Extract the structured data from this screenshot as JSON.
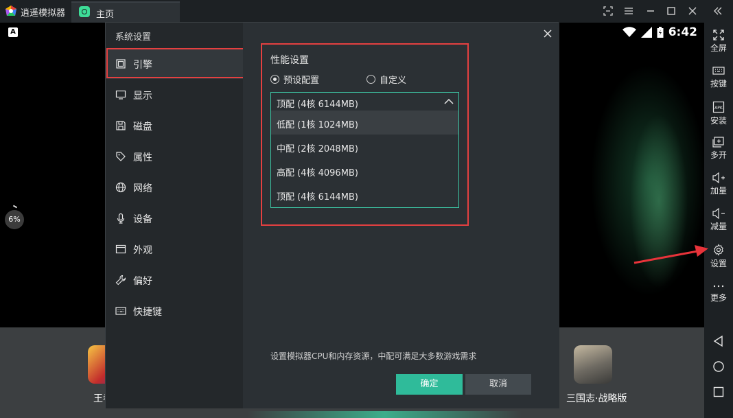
{
  "titlebar": {
    "app_title": "逍遥模拟器",
    "tab_label": "主页",
    "controls": [
      "screenshot-icon",
      "menu-icon",
      "minimize-icon",
      "maximize-icon",
      "close-icon",
      "collapse-icon"
    ]
  },
  "status_bar": {
    "time": "6:42",
    "icons": [
      "wifi-icon",
      "signal-icon",
      "battery-icon"
    ]
  },
  "screen": {
    "progress_percent": "6%",
    "dock_apps": [
      {
        "label": "王者"
      },
      {
        "label": "三国志·战略版"
      }
    ]
  },
  "toolbar": {
    "items": [
      {
        "label": "全屏",
        "icon": "fullscreen-icon"
      },
      {
        "label": "按键",
        "icon": "keyboard-icon"
      },
      {
        "label": "安装",
        "icon": "apk-icon"
      },
      {
        "label": "多开",
        "icon": "multi-instance-icon"
      },
      {
        "label": "加量",
        "icon": "volume-up-icon"
      },
      {
        "label": "减量",
        "icon": "volume-down-icon"
      },
      {
        "label": "设置",
        "icon": "gear-icon"
      },
      {
        "label": "更多",
        "icon": "more-icon"
      }
    ]
  },
  "dialog": {
    "title": "系统设置",
    "nav": [
      {
        "label": "引擎",
        "icon": "engine-icon",
        "active": true
      },
      {
        "label": "显示",
        "icon": "display-icon"
      },
      {
        "label": "磁盘",
        "icon": "disk-icon"
      },
      {
        "label": "属性",
        "icon": "tag-icon"
      },
      {
        "label": "网络",
        "icon": "globe-icon"
      },
      {
        "label": "设备",
        "icon": "microphone-icon"
      },
      {
        "label": "外观",
        "icon": "window-icon"
      },
      {
        "label": "偏好",
        "icon": "wrench-icon"
      },
      {
        "label": "快捷键",
        "icon": "keyboard-icon"
      }
    ],
    "performance": {
      "title": "性能设置",
      "radio_preset": "预设配置",
      "radio_custom": "自定义",
      "selected": "顶配 (4核 6144MB)",
      "options": [
        "低配 (1核 1024MB)",
        "中配 (2核 2048MB)",
        "高配 (4核 4096MB)",
        "顶配 (4核 6144MB)"
      ]
    },
    "hint": "设置模拟器CPU和内存资源，中配可满足大多数游戏需求",
    "ok_label": "确定",
    "cancel_label": "取消"
  },
  "colors": {
    "accent": "#2fbb9a",
    "highlight_box": "#e54040",
    "panel_bg": "#2b3034",
    "sidebar_bg": "#24282b"
  }
}
